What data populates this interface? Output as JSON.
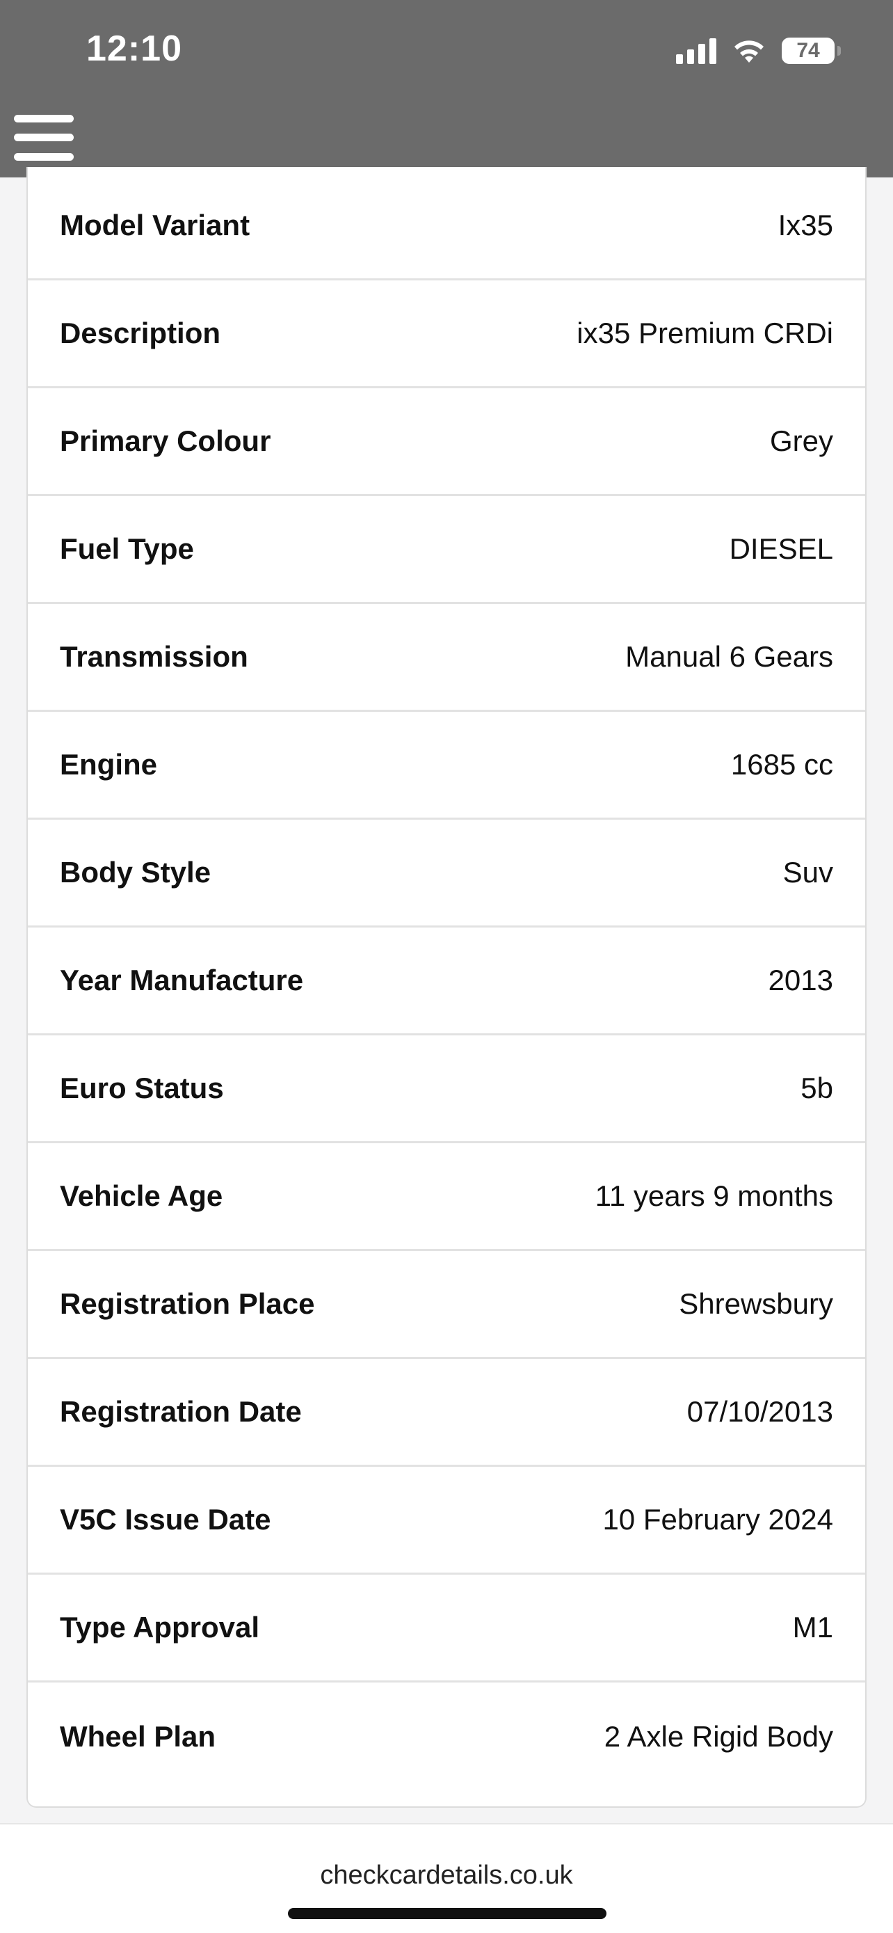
{
  "status_bar": {
    "time": "12:10",
    "battery": "74",
    "icons": [
      "cellular-signal-icon",
      "wifi-icon",
      "battery-icon"
    ]
  },
  "nav": {
    "menu_icon": "hamburger-menu-icon"
  },
  "vehicle_details": [
    {
      "label": "Model Variant",
      "value": "Ix35"
    },
    {
      "label": "Description",
      "value": "ix35 Premium CRDi"
    },
    {
      "label": "Primary Colour",
      "value": "Grey"
    },
    {
      "label": "Fuel Type",
      "value": "DIESEL"
    },
    {
      "label": "Transmission",
      "value": "Manual 6 Gears"
    },
    {
      "label": "Engine",
      "value": "1685 cc"
    },
    {
      "label": "Body Style",
      "value": "Suv"
    },
    {
      "label": "Year Manufacture",
      "value": "2013"
    },
    {
      "label": "Euro Status",
      "value": "5b"
    },
    {
      "label": "Vehicle Age",
      "value": "11 years 9 months"
    },
    {
      "label": "Registration Place",
      "value": "Shrewsbury"
    },
    {
      "label": "Registration Date",
      "value": "07/10/2013"
    },
    {
      "label": "V5C Issue Date",
      "value": "10 February 2024"
    },
    {
      "label": "Type Approval",
      "value": "M1"
    },
    {
      "label": "Wheel Plan",
      "value": "2 Axle Rigid Body"
    }
  ],
  "browser": {
    "url": "checkcardetails.co.uk"
  }
}
